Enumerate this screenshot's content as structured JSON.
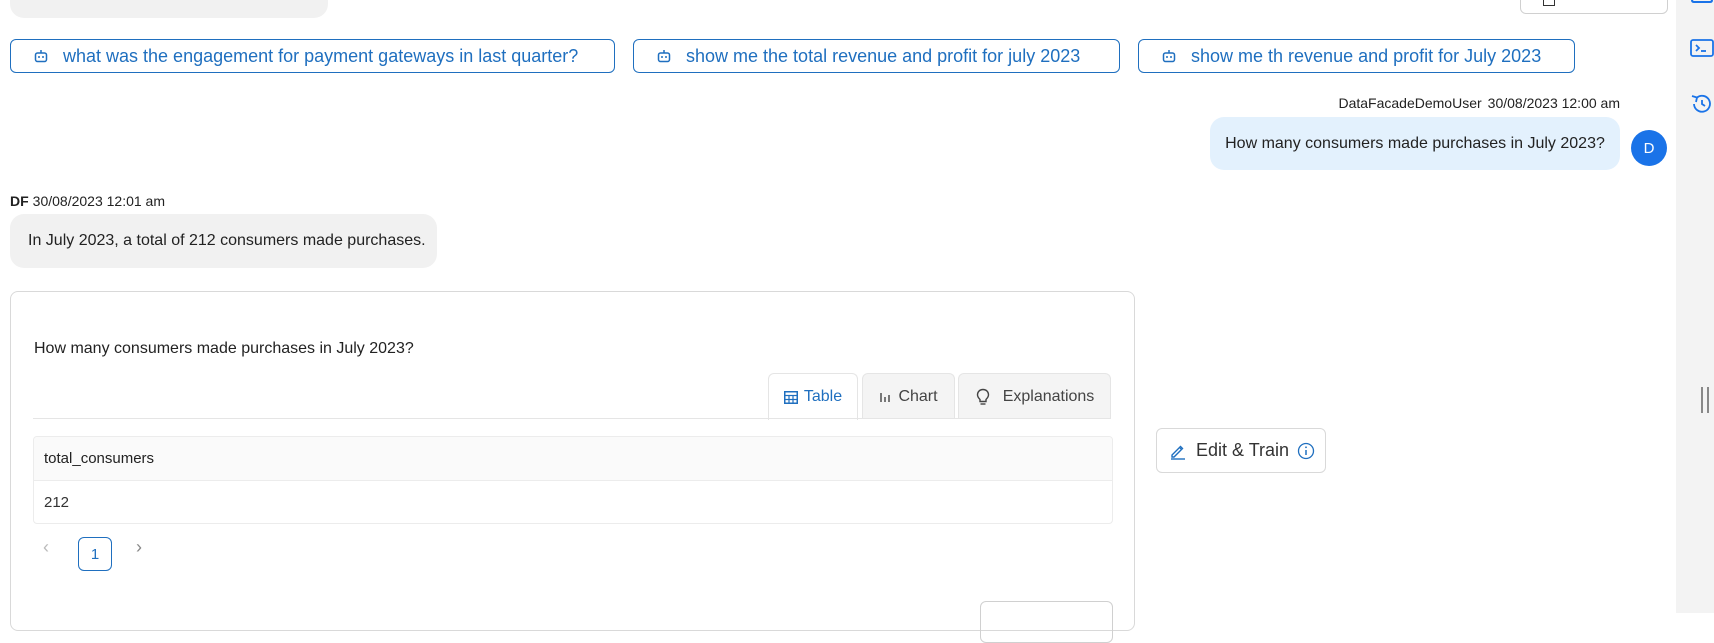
{
  "suggestions": [
    {
      "label": "what was the engagement for payment gateways in last quarter?",
      "icon": "robot-icon"
    },
    {
      "label": "show me the total revenue and profit for july 2023",
      "icon": "robot-icon"
    },
    {
      "label": "show me th revenue and profit for July 2023",
      "icon": "robot-icon"
    }
  ],
  "user_message": {
    "author": "DataFacadeDemoUser",
    "timestamp": "30/08/2023 12:00 am",
    "text": "How many consumers made purchases in July 2023?",
    "avatar_initial": "D"
  },
  "bot_message": {
    "author": "DF",
    "timestamp": "30/08/2023 12:01 am",
    "text": "In July 2023, a total of 212 consumers made purchases."
  },
  "result_card": {
    "question": "How many consumers made purchases in July 2023?",
    "tabs": [
      {
        "label": "Table",
        "icon": "table-icon",
        "active": true
      },
      {
        "label": "Chart",
        "icon": "bar-chart-icon",
        "active": false
      },
      {
        "label": "Explanations",
        "icon": "lightbulb-icon",
        "active": false
      }
    ],
    "table": {
      "columns": [
        "total_consumers"
      ],
      "rows": [
        [
          "212"
        ]
      ]
    },
    "pagination": {
      "prev": "‹",
      "current_page": "1",
      "next": "›"
    }
  },
  "edit_train": {
    "label": "Edit & Train"
  },
  "colors": {
    "accent": "#1f6fbf",
    "user_bubble": "#e3f1fd",
    "bot_bubble": "#f1f1f1",
    "avatar": "#1a73e8"
  }
}
